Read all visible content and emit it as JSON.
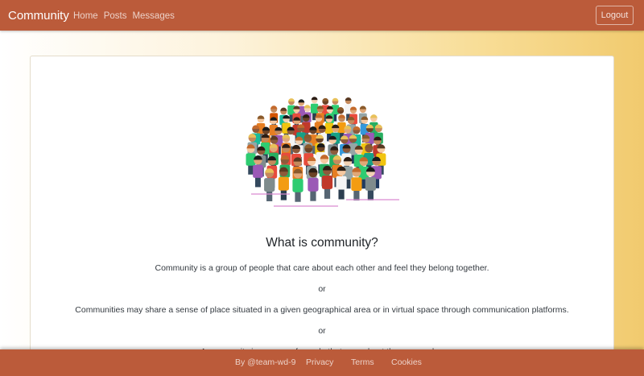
{
  "navbar": {
    "brand": "Community",
    "links": [
      "Home",
      "Posts",
      "Messages"
    ],
    "logout_label": "Logout"
  },
  "content": {
    "heading": "What is community?",
    "paragraphs": [
      "Community is a group of people that care about each other and feel they belong together.",
      "or",
      "Communities may share a sense of place situated in a given geographical area or in virtual space through communication platforms.",
      "or",
      "A community is a group of people that care about the area and ..."
    ]
  },
  "footer": {
    "byline": "By @team-wd-9",
    "links": [
      "Privacy",
      "Terms",
      "Cookies"
    ]
  },
  "colors": {
    "bar": "#bb5b3a",
    "background_gradient": [
      "#ffffff",
      "#f1ca6e"
    ]
  },
  "icons": {
    "illustration": "crowd-of-people-illustration"
  }
}
